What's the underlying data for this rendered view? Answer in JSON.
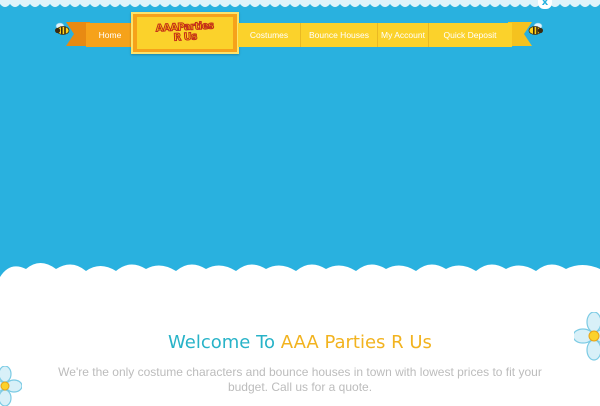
{
  "colors": {
    "sky": "#29b1df",
    "nav_orange": "#f6a21a",
    "nav_yellow": "#fbd22b",
    "heading_teal": "#28b3c8",
    "heading_yellow": "#f2b31f",
    "body_text": "#bcbcbc"
  },
  "window": {
    "close_symbol": "x"
  },
  "nav": {
    "home": "Home",
    "costumes": "Costumes",
    "bounce_houses": "Bounce Houses",
    "my_account": "My Account",
    "quick_deposit": "Quick Deposit"
  },
  "logo": {
    "line1": "AAAParties",
    "line2": "R Us"
  },
  "icons": {
    "mascot": "bee-icon",
    "decoration": "flower-icon"
  },
  "welcome": {
    "prefix": "Welcome To ",
    "brand": "AAA Parties R Us",
    "description": "We're the only costume characters and bounce houses in town with lowest prices to fit your budget. Call us for a quote."
  }
}
